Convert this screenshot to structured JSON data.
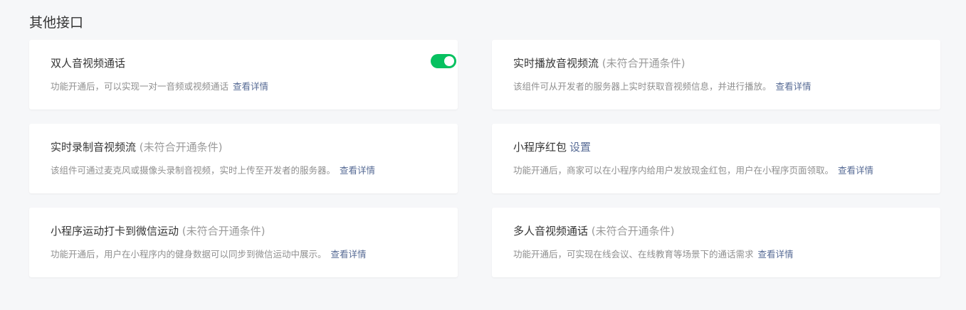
{
  "section": {
    "title": "其他接口"
  },
  "colors": {
    "accent": "#07c160",
    "link": "#576b95",
    "muted": "#9a9a9a"
  },
  "cards": [
    {
      "title": "双人音视频通话",
      "status": "",
      "setting_link": "",
      "desc": "功能开通后，可以实现一对一音频或视频通话",
      "detail_link": "查看详情",
      "toggle_on": true
    },
    {
      "title": "实时播放音视频流",
      "status": "(未符合开通条件)",
      "setting_link": "",
      "desc": "该组件可从开发者的服务器上实时获取音视频信息，并进行播放。",
      "detail_link": "查看详情",
      "toggle_on": false
    },
    {
      "title": "实时录制音视频流",
      "status": "(未符合开通条件)",
      "setting_link": "",
      "desc": "该组件可通过麦克风或摄像头录制音视频，实时上传至开发者的服务器。",
      "detail_link": "查看详情",
      "toggle_on": false
    },
    {
      "title": "小程序红包",
      "status": "",
      "setting_link": "设置",
      "desc": "功能开通后，商家可以在小程序内给用户发放现金红包，用户在小程序页面领取。",
      "detail_link": "查看详情",
      "toggle_on": false
    },
    {
      "title": "小程序运动打卡到微信运动",
      "status": "(未符合开通条件)",
      "setting_link": "",
      "desc": "功能开通后，用户在小程序内的健身数据可以同步到微信运动中展示。",
      "detail_link": "查看详情",
      "toggle_on": false
    },
    {
      "title": "多人音视频通话",
      "status": "(未符合开通条件)",
      "setting_link": "",
      "desc": "功能开通后，可实现在线会议、在线教育等场景下的通话需求",
      "detail_link": "查看详情",
      "toggle_on": false
    }
  ]
}
